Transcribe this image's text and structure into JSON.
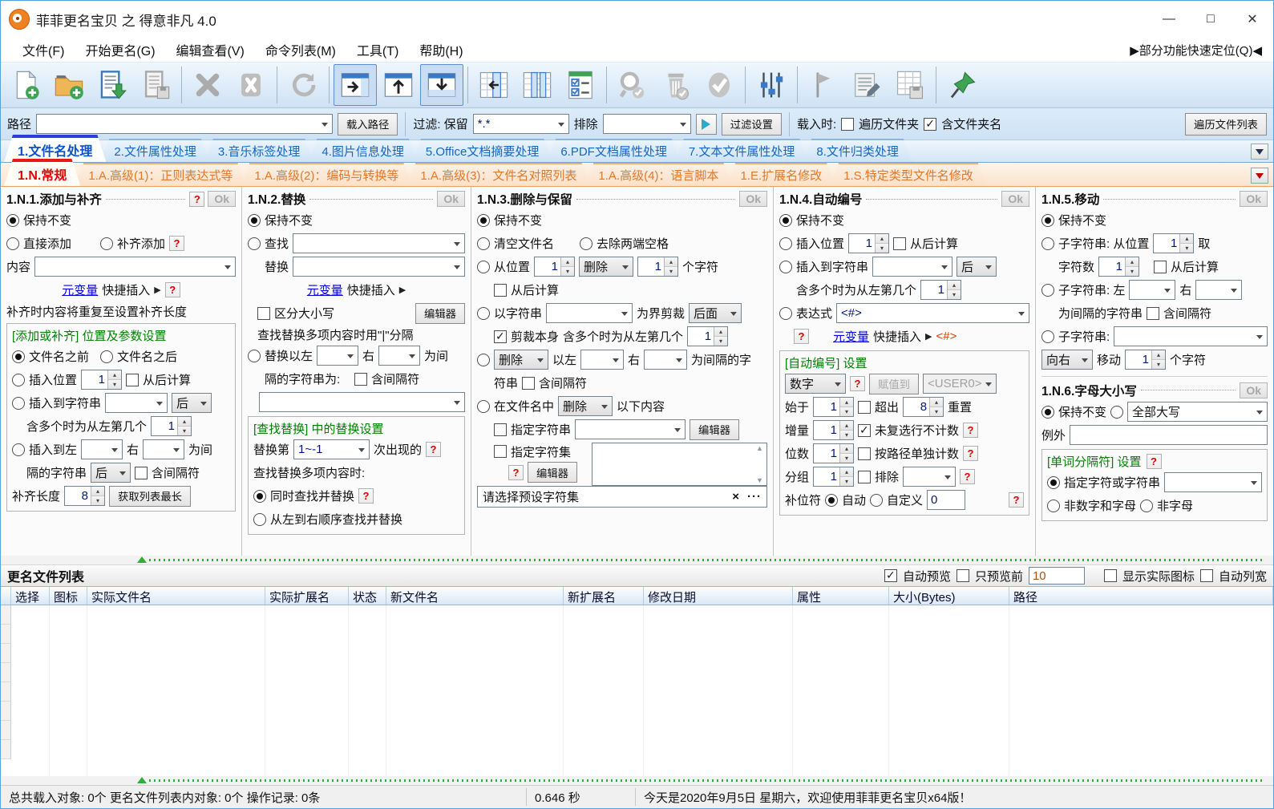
{
  "colors": {
    "accent_blue": "#2b3fd6",
    "tab_blue_text": "#1565c5",
    "tab_orange_text": "#e2782a",
    "active_red": "#e20000",
    "green_title": "#008000",
    "link_blue": "#0000dd",
    "help_red": "#e00000",
    "splitter_green": "#2fae3a"
  },
  "icons": {
    "app": "app-logo-icon",
    "toolbar": [
      "new-file-icon",
      "open-folder-add-icon",
      "import-list-icon",
      "save-list-icon",
      "remove-item-icon",
      "remove-all-icon",
      "refresh-icon",
      "show-right-panel-icon",
      "show-top-panel-icon",
      "show-bottom-panel-icon",
      "move-column-left-icon",
      "columns-layout-icon",
      "check-options-icon",
      "search-icon",
      "trash-icon",
      "confirm-icon",
      "settings-sliders-icon",
      "flag-icon",
      "edit-log-icon",
      "export-table-icon",
      "pin-icon"
    ]
  },
  "win": {
    "title": "菲菲更名宝贝 之 得意非凡 4.0",
    "min": "—",
    "max": "□",
    "close": "✕"
  },
  "menu": {
    "items": [
      "文件(F)",
      "开始更名(G)",
      "编辑查看(V)",
      "命令列表(M)",
      "工具(T)",
      "帮助(H)"
    ],
    "quick": "▶部分功能快速定位(Q)◀"
  },
  "path": {
    "label": "路径",
    "load": "载入路径",
    "filter": "过滤: 保留",
    "filter_val": "*.*",
    "exclude": "排除",
    "settings": "过滤设置",
    "load_when": "载入时:",
    "walk": "遍历文件夹",
    "incl_folder": "含文件夹名",
    "walk_list": "遍历文件列表"
  },
  "tabs1": [
    "1.文件名处理",
    "2.文件属性处理",
    "3.音乐标签处理",
    "4.图片信息处理",
    "5.Office文档摘要处理",
    "6.PDF文档属性处理",
    "7.文本文件属性处理",
    "8.文件归类处理"
  ],
  "tabs2": [
    "1.N.常规",
    "1.A.高级(1)：正则表达式等",
    "1.A.高级(2)：编码与转换等",
    "1.A.高级(3)：文件名对照列表",
    "1.A.高级(4)：语言脚本",
    "1.E.扩展名修改",
    "1.S.特定类型文件名修改"
  ],
  "p1": {
    "title": "1.N.1.添加与补齐",
    "help": "?",
    "ok": "Ok",
    "keep": "保持不变",
    "add_direct": "直接添加",
    "add_pad": "补齐添加",
    "content": "内容",
    "var_link": "元变量",
    "var_rest": "快捷插入",
    "var_arrow": "▶",
    "note": "补齐时内容将重复至设置补齐长度",
    "group": "[添加或补齐] 位置及参数设置",
    "before": "文件名之前",
    "after": "文件名之后",
    "ins_pos": "插入位置",
    "ins_pos_val": "1",
    "from_end": "从后计算",
    "ins_str": "插入到字符串",
    "after_cb": "后",
    "nth": "含多个时为从左第几个",
    "nth_val": "1",
    "ins_between": "插入到左",
    "right": "右",
    "tail1": "为间",
    "tail2": "隔的字符串",
    "sep_cb": "后",
    "incl_sep": "含间隔符",
    "pad_len": "补齐长度",
    "pad_len_val": "8",
    "get_longest": "获取列表最长"
  },
  "p2": {
    "title": "1.N.2.替换",
    "ok": "Ok",
    "keep": "保持不变",
    "find": "查找",
    "repl": "替换",
    "var_link": "元变量",
    "var_rest": "快捷插入",
    "var_arrow": "▶",
    "case_sens": "区分大小写",
    "editor": "编辑器",
    "note": "查找替换多项内容时用\"|\"分隔",
    "repl_between": "替换以左",
    "right": "右",
    "tail1": "为间",
    "tail2": "隔的字符串为:",
    "incl_sep": "含间隔符",
    "group": "[查找替换] 中的替换设置",
    "nth_label": "替换第",
    "nth_val": "1~-1",
    "nth_tail": "次出现的",
    "help": "?",
    "multi_label": "查找替换多项内容时:",
    "simult": "同时查找并替换",
    "seq": "从左到右顺序查找并替换"
  },
  "p3": {
    "title": "1.N.3.删除与保留",
    "ok": "Ok",
    "keep": "保持不变",
    "clear": "清空文件名",
    "trim": "去除两端空格",
    "from_pos": "从位置",
    "pos_val": "1",
    "del_cb": "删除",
    "cnt_val": "1",
    "chars": "个字符",
    "from_end": "从后计算",
    "by_str": "以字符串",
    "cut": "为界剪裁",
    "cut_cb": "后面",
    "cut_self": "剪裁本身",
    "nth": "含多个时为从左第几个",
    "nth_val": "1",
    "del2_cb": "删除",
    "between_l": "以左",
    "right": "右",
    "tail1": "为间隔的字",
    "tail2": "符串",
    "incl_sep": "含间隔符",
    "in_name": "在文件名中",
    "del3_cb": "删除",
    "following": "以下内容",
    "spec_str": "指定字符串",
    "editor": "编辑器",
    "spec_set": "指定字符集",
    "help": "?",
    "editor2": "编辑器",
    "preset": "请选择预设字符集",
    "close": "×",
    "more": "···"
  },
  "p4": {
    "title": "1.N.4.自动编号",
    "ok": "Ok",
    "keep": "保持不变",
    "ins_pos": "插入位置",
    "pos_val": "1",
    "from_end": "从后计算",
    "ins_str": "插入到字符串",
    "after_cb": "后",
    "nth": "含多个时为从左第几个",
    "nth_val": "1",
    "expr": "表达式",
    "expr_val": "<#>",
    "help": "?",
    "var_link": "元变量",
    "var_rest": "快捷插入",
    "var_arrow": "▶",
    "var_tag": "<#>",
    "group": "[自动编号] 设置",
    "type_cb": "数字",
    "assign": "赋值到",
    "assign_cb": "<USER0>",
    "start": "始于",
    "start_val": "1",
    "over": "超出",
    "over_val": "8",
    "reset": "重置",
    "inc": "增量",
    "inc_val": "1",
    "nocount": "未复选行不计数",
    "digits": "位数",
    "digits_val": "1",
    "bypath": "按路径单独计数",
    "grp": "分组",
    "grp_val": "1",
    "excl": "排除",
    "pad": "补位符",
    "auto": "自动",
    "custom": "自定义",
    "custom_val": "0"
  },
  "p5": {
    "title": "1.N.5.移动",
    "ok": "Ok",
    "keep": "保持不变",
    "sub1": "子字符串: 从位置",
    "pos_val": "1",
    "take": "取",
    "count": "字符数",
    "count_val": "1",
    "from_end": "从后计算",
    "sub2": "子字符串: 左",
    "right": "右",
    "tail": "为间隔的字符串",
    "incl_sep": "含间隔符",
    "sub3": "子字符串:",
    "dir_cb": "向右",
    "move": "移动",
    "move_val": "1",
    "chars": "个字符"
  },
  "p6": {
    "title": "1.N.6.字母大小写",
    "ok": "Ok",
    "keep": "保持不变",
    "case_cb": "全部大写",
    "except": "例外",
    "group": "[单词分隔符] 设置",
    "help": "?",
    "spec": "指定字符或字符串",
    "nonan": "非数字和字母",
    "nonalpha": "非字母"
  },
  "list": {
    "title": "更名文件列表",
    "auto_prev": "自动预览",
    "prev_first": "只预览前",
    "prev_n": "10",
    "real_icons": "显示实际图标",
    "auto_width": "自动列宽",
    "cols": [
      "选择",
      "图标",
      "实际文件名",
      "实际扩展名",
      "状态",
      "新文件名",
      "新扩展名",
      "修改日期",
      "属性",
      "大小(Bytes)",
      "路径"
    ]
  },
  "status": {
    "objs": "总共载入对象: 0个  更名文件列表内对象: 0个  操作记录: 0条",
    "time": "0.646 秒",
    "greet": "今天是2020年9月5日 星期六，欢迎使用菲菲更名宝贝x64版！"
  }
}
